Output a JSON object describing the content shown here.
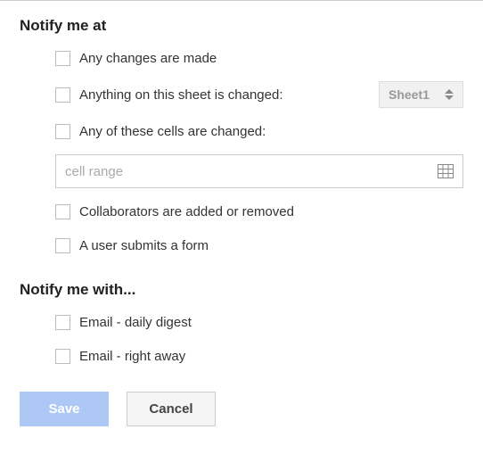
{
  "notify_at": {
    "header": "Notify me at",
    "options": {
      "any_changes": "Any changes are made",
      "sheet_changed": "Anything on this sheet is changed:",
      "cells_changed": "Any of these cells are changed:",
      "collaborators": "Collaborators are added or removed",
      "form_submit": "A user submits a form"
    },
    "sheet_select": {
      "value": "Sheet1"
    },
    "cell_range": {
      "placeholder": "cell range",
      "value": ""
    }
  },
  "notify_with": {
    "header": "Notify me with...",
    "options": {
      "daily_digest": "Email - daily digest",
      "right_away": "Email - right away"
    }
  },
  "buttons": {
    "save": "Save",
    "cancel": "Cancel"
  }
}
